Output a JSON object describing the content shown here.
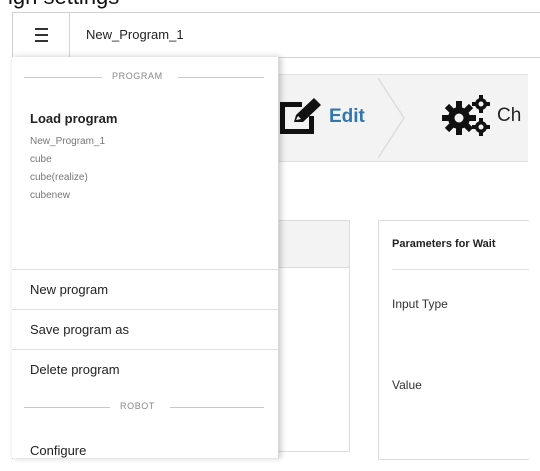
{
  "top_strip_text": "ign settings",
  "titlebar": {
    "program_name": "New_Program_1"
  },
  "steps": {
    "edit_label": "Edit",
    "next_label_partial": "Ch"
  },
  "parameters": {
    "title": "Parameters for  Wait",
    "input_type_label": "Input Type",
    "value_label": "Value"
  },
  "drawer": {
    "program_section": "PROGRAM",
    "load_program": "Load program",
    "programs": [
      "New_Program_1",
      "cube",
      "cube(realize)",
      "cubenew"
    ],
    "new_program": "New program",
    "save_program_as": "Save program as",
    "delete_program": "Delete program",
    "robot_section": "ROBOT",
    "configure": "Configure"
  },
  "colors": {
    "accent": "#3276b1",
    "step_bg": "#f3f3f3"
  },
  "icons": {
    "menu": "hamburger-icon",
    "edit": "edit-icon",
    "settings": "gears-icon"
  }
}
